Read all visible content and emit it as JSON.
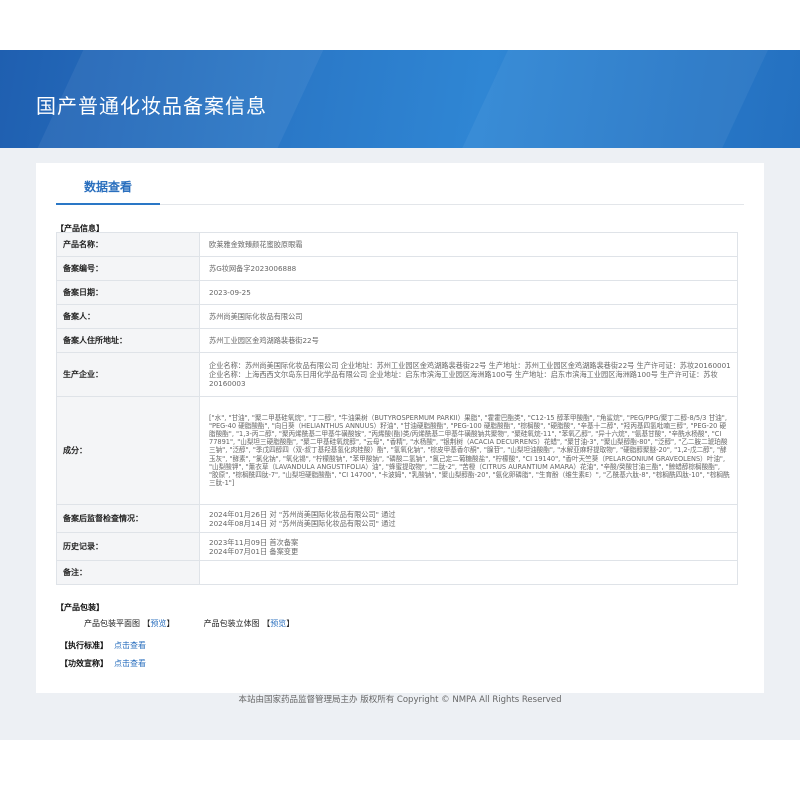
{
  "banner": {
    "title": "国产普通化妆品备案信息"
  },
  "tabs": {
    "active": "数据查看"
  },
  "sections": {
    "product_info": "【产品信息】",
    "product_package": "【产品包装】",
    "exec_standard": "【执行标准】",
    "efficacy": "【功效宣称】"
  },
  "info_rows": {
    "name": {
      "label": "产品名称：",
      "value": "欧莱雅金致臻颜花蜜胶原眼霜"
    },
    "record_no": {
      "label": "备案编号：",
      "value": "苏G妆网备字2023006888"
    },
    "record_date": {
      "label": "备案日期：",
      "value": "2023-09-25"
    },
    "filer": {
      "label": "备案人：",
      "value": "苏州尚美国际化妆品有限公司"
    },
    "filer_address": {
      "label": "备案人住所地址：",
      "value": "苏州工业园区金鸡湖路裴巷街22号"
    },
    "producer": {
      "label": "生产企业：",
      "value": "企业名称：苏州尚美国际化妆品有限公司 企业地址：苏州工业园区金鸡湖路裴巷街22号 生产地址：苏州工业园区金鸡湖路裴巷街22号 生产许可证：苏妆20160001\n企业名称：上海西西文尔岛东日用化学品有限公司 企业地址：启东市滨海工业园区海洲路100号 生产地址：启东市滨海工业园区海洲路100号 生产许可证：苏妆20160003"
    },
    "ingredients": {
      "label": "成分：",
      "value": "[\"水\", \"甘油\", \"聚二甲基硅氧烷\", \"丁二醇\", \"牛油果树（BUTYROSPERMUM PARKII）果脂\", \"霍霍巴酯类\", \"C12-15 醇苯甲酸酯\", \"角鲨烷\", \"PEG/PPG/聚丁二醇-8/5/3 甘油\", \"PEG-40 硬脂酸酯\", \"向日葵（HELIANTHUS ANNUUS）籽油\", \"甘油硬脂酸酯\", \"PEG-100 硬脂酸酯\", \"棕榈酸\", \"硬脂酸\", \"辛基十二醇\", \"羟丙基四氢吡喃三醇\", \"PEG-20 硬脂酸酯\", \"1,3-丙二醇\", \"聚丙烯酰基二甲基牛磺酸铵\", \"丙烯酸(酯)类/丙烯酰基二甲基牛磺酸钠共聚物\", \"聚硅氧烷-11\", \"苯氧乙醇\", \"异十六烷\", \"氨基甘酸\", \"辛酰水杨酸\", \"CI 77891\", \"山梨坦三硬脂酸酯\", \"聚二甲基硅氧烷醇\", \"云母\", \"香精\", \"水杨酸\", \"银荆树（ACACIA DECURRENS）花蜡\", \"聚甘油-3\", \"聚山梨醇酯-80\", \"泛醇\", \"乙二胺二琥珀酸三钠\", \"泛醇\", \"季戊四醇四（双-叔丁基羟基氢化肉桂酸）酯\", \"氢氧化钠\", \"棕皮甲基香尔酮\", \"腺苷\", \"山梨坦油酸酯\", \"水解亚麻籽提取物\", \"硬脂醇聚醚-20\", \"1,2-戊二醇\", \"酵玉灰\", \"酵素\", \"氯化钠\", \"氧化锡\", \"柠檬酸钠\", \"苯甲酸钠\", \"磷酸二氢钠\", \"氯己定二葡糖酸盐\", \"柠檬酸\", \"CI 19140\", \"香叶天竺葵（PELARGONIUM GRAVEOLENS）叶油\", \"山梨酸钾\", \"薰衣草（LAVANDULA ANGUSTIFOLIA）油\", \"蜂蜜提取物\", \"二肽-2\", \"苦橙（CITRUS AURANTIUM AMARA）花油\", \"辛酸/癸酸甘油三酯\", \"鲸蜡醇棕榈酸酯\", \"胶原\", \"棕榈酰四肽-7\", \"山梨坦硬脂酸酯\", \"CI 14700\", \"卡波姆\", \"乳酸钠\", \"聚山梨醇酯-20\", \"氨化卵磷脂\", \"生育酚（维生素E）\", \"乙酰基六肽-8\", \"棕榈酰四肽-10\", \"棕榈酰三肽-1\"]"
    },
    "post_check": {
      "label": "备案后监督检查情况：",
      "value": "2024年01月26日 对 \"苏州尚美国际化妆品有限公司\" 通过\n2024年08月14日 对 \"苏州尚美国际化妆品有限公司\" 通过"
    },
    "history": {
      "label": "历史记录：",
      "value": "2023年11月09日 首次备案\n2024年07月01日 备案变更"
    },
    "remarks": {
      "label": "备注：",
      "value": ""
    }
  },
  "package": {
    "plan_label": "产品包装平面图",
    "plan_link": "预览",
    "stereo_label": "产品包装立体图",
    "stereo_link": "预览",
    "bracket_open": "【",
    "bracket_close": "】"
  },
  "links": {
    "exec_standard": "点击查看",
    "efficacy": "点击查看"
  },
  "footer": {
    "text": "本站由国家药品监督管理局主办 版权所有 Copyright © NMPA All Rights Reserved"
  }
}
